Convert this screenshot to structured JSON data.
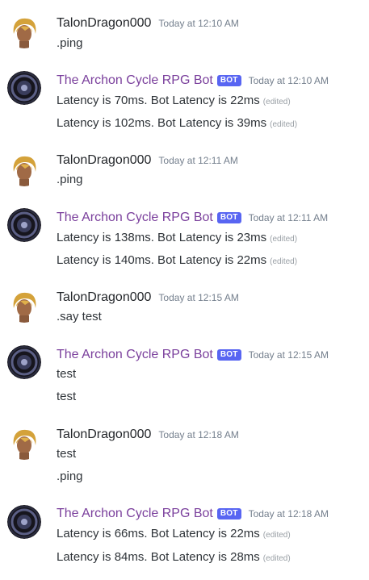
{
  "messages": [
    {
      "author": "TalonDragon000",
      "timestamp": "Today at 12:10 AM",
      "lines": [
        {
          "text": ".ping",
          "edited": ""
        }
      ]
    },
    {
      "author": "The Archon Cycle RPG Bot",
      "bot_tag": "BOT",
      "timestamp": "Today at 12:10 AM",
      "lines": [
        {
          "text": "Latency is 70ms. Bot Latency is 22ms",
          "edited": "(edited)"
        },
        {
          "text": "Latency is 102ms. Bot Latency is 39ms",
          "edited": "(edited)"
        }
      ]
    },
    {
      "author": "TalonDragon000",
      "timestamp": "Today at 12:11 AM",
      "lines": [
        {
          "text": ".ping",
          "edited": ""
        }
      ]
    },
    {
      "author": "The Archon Cycle RPG Bot",
      "bot_tag": "BOT",
      "timestamp": "Today at 12:11 AM",
      "lines": [
        {
          "text": "Latency is 138ms. Bot Latency is 23ms",
          "edited": "(edited)"
        },
        {
          "text": "Latency is 140ms. Bot Latency is 22ms",
          "edited": "(edited)"
        }
      ]
    },
    {
      "author": "TalonDragon000",
      "timestamp": "Today at 12:15 AM",
      "lines": [
        {
          "text": ".say test",
          "edited": ""
        }
      ]
    },
    {
      "author": "The Archon Cycle RPG Bot",
      "bot_tag": "BOT",
      "timestamp": "Today at 12:15 AM",
      "lines": [
        {
          "text": "test",
          "edited": ""
        },
        {
          "text": "test",
          "edited": ""
        }
      ]
    },
    {
      "author": "TalonDragon000",
      "timestamp": "Today at 12:18 AM",
      "lines": [
        {
          "text": "test",
          "edited": ""
        },
        {
          "text": ".ping",
          "edited": ""
        }
      ]
    },
    {
      "author": "The Archon Cycle RPG Bot",
      "bot_tag": "BOT",
      "timestamp": "Today at 12:18 AM",
      "lines": [
        {
          "text": "Latency is 66ms. Bot Latency is 22ms",
          "edited": "(edited)"
        },
        {
          "text": "Latency is 84ms. Bot Latency is 28ms",
          "edited": "(edited)"
        }
      ]
    }
  ]
}
